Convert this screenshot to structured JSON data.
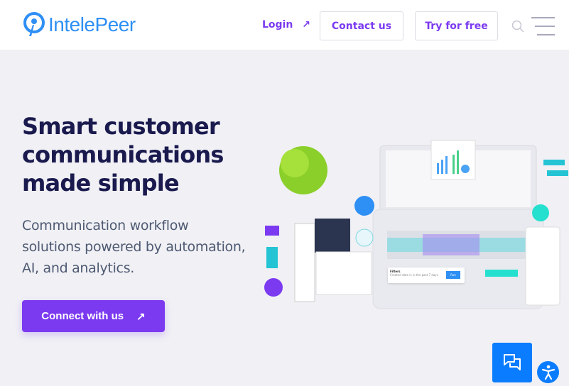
{
  "header": {
    "logo_text": "IntelePeer",
    "login_label": "Login",
    "contact_label": "Contact us",
    "trial_label": "Try for free"
  },
  "hero": {
    "headline": "Smart customer communications made simple",
    "subtitle": "Communication workflow solutions powered by automation, AI, and analytics.",
    "cta_label": "Connect with us",
    "illustration": {
      "filters_title": "Filters",
      "filters_text": "Created date is in the past 7 days",
      "run_label": "Run"
    }
  },
  "colors": {
    "brand_blue": "#2e8ff5",
    "accent_purple": "#7b3af0",
    "headline": "#1a1a4e",
    "chat_blue": "#0a7cff"
  },
  "widgets": {
    "chat_icon": "chat-bubbles-icon",
    "accessibility_icon": "accessibility-icon"
  }
}
